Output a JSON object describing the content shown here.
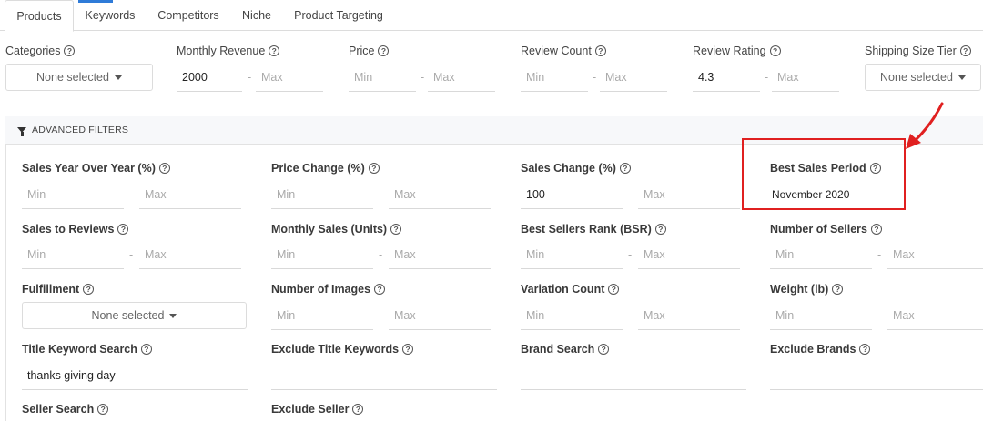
{
  "tabs": [
    {
      "label": "Products"
    },
    {
      "label": "Keywords"
    },
    {
      "label": "Competitors"
    },
    {
      "label": "Niche"
    },
    {
      "label": "Product Targeting"
    }
  ],
  "top_filters": {
    "categories": {
      "label": "Categories",
      "value": "None selected"
    },
    "monthly_revenue": {
      "label": "Monthly Revenue",
      "min": "2000",
      "max_placeholder": "Max"
    },
    "price": {
      "label": "Price",
      "min_placeholder": "Min",
      "max_placeholder": "Max"
    },
    "review_count": {
      "label": "Review Count",
      "min_placeholder": "Min",
      "max_placeholder": "Max"
    },
    "review_rating": {
      "label": "Review Rating",
      "min": "4.3",
      "max_placeholder": "Max"
    },
    "shipping_size_tier": {
      "label": "Shipping Size Tier",
      "value": "None selected"
    }
  },
  "advanced": {
    "header": "ADVANCED FILTERS",
    "sales_yoy": {
      "label": "Sales Year Over Year (%)",
      "min_placeholder": "Min",
      "max_placeholder": "Max"
    },
    "price_change": {
      "label": "Price Change (%)",
      "min_placeholder": "Min",
      "max_placeholder": "Max"
    },
    "sales_change": {
      "label": "Sales Change (%)",
      "min": "100",
      "max_placeholder": "Max"
    },
    "best_sales_period": {
      "label": "Best Sales Period",
      "value": "November 2020"
    },
    "sales_to_reviews": {
      "label": "Sales to Reviews",
      "min_placeholder": "Min",
      "max_placeholder": "Max"
    },
    "monthly_sales": {
      "label": "Monthly Sales (Units)",
      "min_placeholder": "Min",
      "max_placeholder": "Max"
    },
    "bsr": {
      "label": "Best Sellers Rank (BSR)",
      "min_placeholder": "Min",
      "max_placeholder": "Max"
    },
    "number_of_sellers": {
      "label": "Number of Sellers",
      "min_placeholder": "Min",
      "max_placeholder": "Max"
    },
    "fulfillment": {
      "label": "Fulfillment",
      "value": "None selected"
    },
    "number_of_images": {
      "label": "Number of Images",
      "min_placeholder": "Min",
      "max_placeholder": "Max"
    },
    "variation_count": {
      "label": "Variation Count",
      "min_placeholder": "Min",
      "max_placeholder": "Max"
    },
    "weight": {
      "label": "Weight (lb)",
      "min_placeholder": "Min",
      "max_placeholder": "Max"
    },
    "title_keyword_search": {
      "label": "Title Keyword Search",
      "value": "thanks giving day"
    },
    "exclude_title_keywords": {
      "label": "Exclude Title Keywords"
    },
    "brand_search": {
      "label": "Brand Search"
    },
    "exclude_brands": {
      "label": "Exclude Brands"
    },
    "seller_search": {
      "label": "Seller Search"
    },
    "exclude_seller": {
      "label": "Exclude Seller"
    }
  },
  "dash": "-",
  "help_glyph": "?",
  "colors": {
    "accent": "#2f7bd8",
    "highlight": "#e02020"
  }
}
